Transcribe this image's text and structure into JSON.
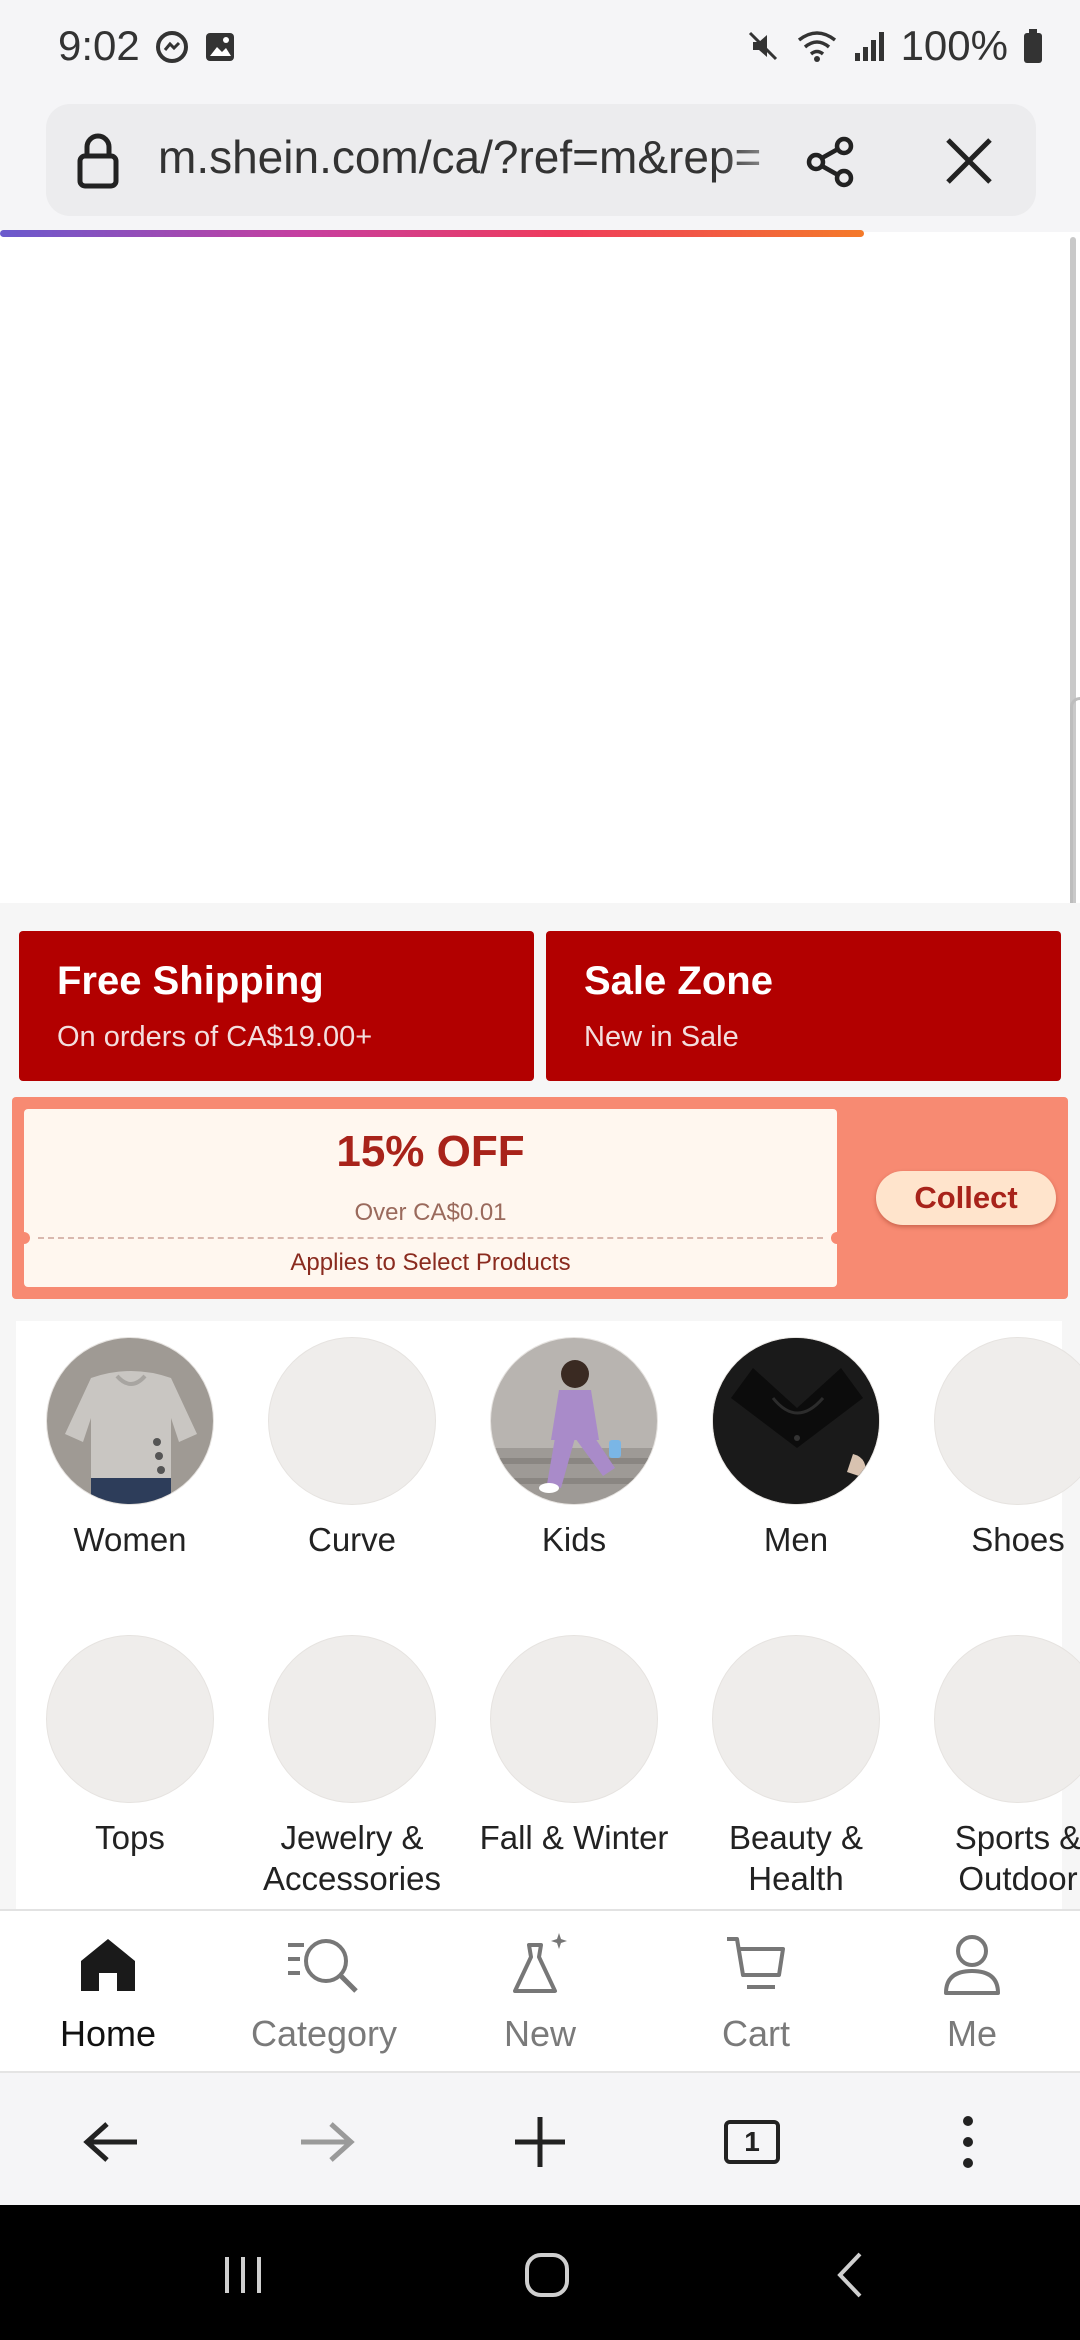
{
  "status_bar": {
    "time": "9:02",
    "battery": "100%"
  },
  "browser": {
    "url": "m.shein.com/ca/?ref=m&rep=",
    "load_progress": 0.8
  },
  "promos": {
    "free_shipping": {
      "title": "Free Shipping",
      "subtitle": "On orders of CA$19.00+"
    },
    "sale_zone": {
      "title": "Sale Zone",
      "subtitle": "New in Sale"
    }
  },
  "coupon": {
    "discount": "15% OFF",
    "condition": "Over CA$0.01",
    "note": "Applies to Select Products",
    "collect_label": "Collect"
  },
  "categories": [
    {
      "label": "Women",
      "image": "gray-knit-top"
    },
    {
      "label": "Curve",
      "image": "placeholder"
    },
    {
      "label": "Kids",
      "image": "purple-outfit-kid"
    },
    {
      "label": "Men",
      "image": "black-polo"
    },
    {
      "label": "Shoes",
      "image": "placeholder"
    },
    {
      "label": "Tops",
      "image": "placeholder"
    },
    {
      "label": "Jewelry & Accessories",
      "image": "placeholder"
    },
    {
      "label": "Fall & Winter",
      "image": "placeholder"
    },
    {
      "label": "Beauty & Health",
      "image": "placeholder"
    },
    {
      "label": "Sports & Outdoor",
      "image": "placeholder"
    }
  ],
  "app_nav": [
    {
      "label": "Home",
      "icon": "home-icon",
      "active": true
    },
    {
      "label": "Category",
      "icon": "category-search-icon",
      "active": false
    },
    {
      "label": "New",
      "icon": "dress-sparkle-icon",
      "active": false
    },
    {
      "label": "Cart",
      "icon": "cart-icon",
      "active": false
    },
    {
      "label": "Me",
      "icon": "person-icon",
      "active": false
    }
  ],
  "browser_toolbar": {
    "tab_count": "1"
  },
  "colors": {
    "promo_red": "#b20000",
    "coupon_strip": "#f78a72",
    "coupon_text": "#a8231a"
  }
}
